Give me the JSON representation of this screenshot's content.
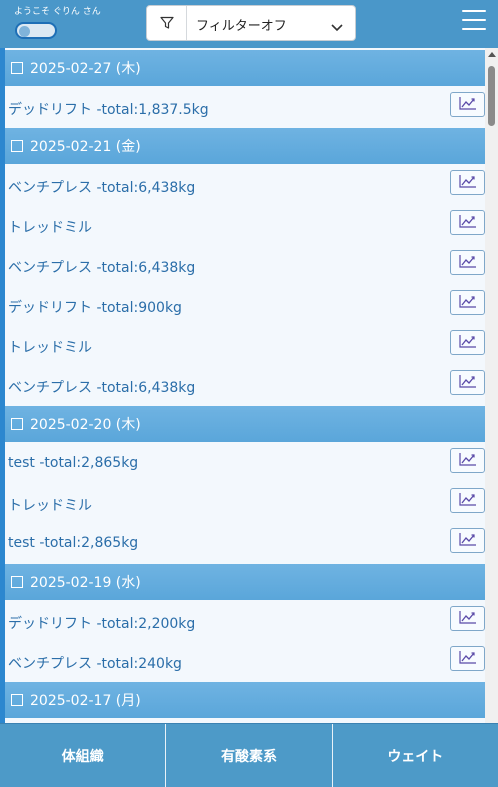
{
  "header": {
    "welcome": "ようこそ ぐりん さん",
    "filter_value": "フィルターオフ"
  },
  "list": {
    "sections": [
      {
        "date": "2025-02-27 (木)",
        "items": [
          "デッドリフト -total:1,837.5kg"
        ]
      },
      {
        "date": "2025-02-21 (金)",
        "items": [
          "ベンチプレス -total:6,438kg",
          "トレッドミル",
          "ベンチプレス -total:6,438kg",
          "デッドリフト -total:900kg",
          "トレッドミル",
          "ベンチプレス -total:6,438kg"
        ]
      },
      {
        "date": "2025-02-20 (木)",
        "items": [
          "test -total:2,865kg",
          "トレッドミル",
          "test -total:2,865kg"
        ]
      },
      {
        "date": "2025-02-19 (水)",
        "items": [
          "デッドリフト -total:2,200kg",
          "ベンチプレス -total:240kg"
        ]
      },
      {
        "date": "2025-02-17 (月)",
        "items": []
      }
    ]
  },
  "tabs": [
    "体組織",
    "有酸素系",
    "ウェイト"
  ],
  "icons": {
    "filter": "filter-icon",
    "dropdown": "chevron-down-icon",
    "menu": "hamburger-menu-icon",
    "chart": "chart-icon"
  },
  "colors": {
    "header": "#4a97c9",
    "date_row": "#62ace0",
    "item_text": "#2b6ea9",
    "list_bg": "#f3f8fd"
  }
}
